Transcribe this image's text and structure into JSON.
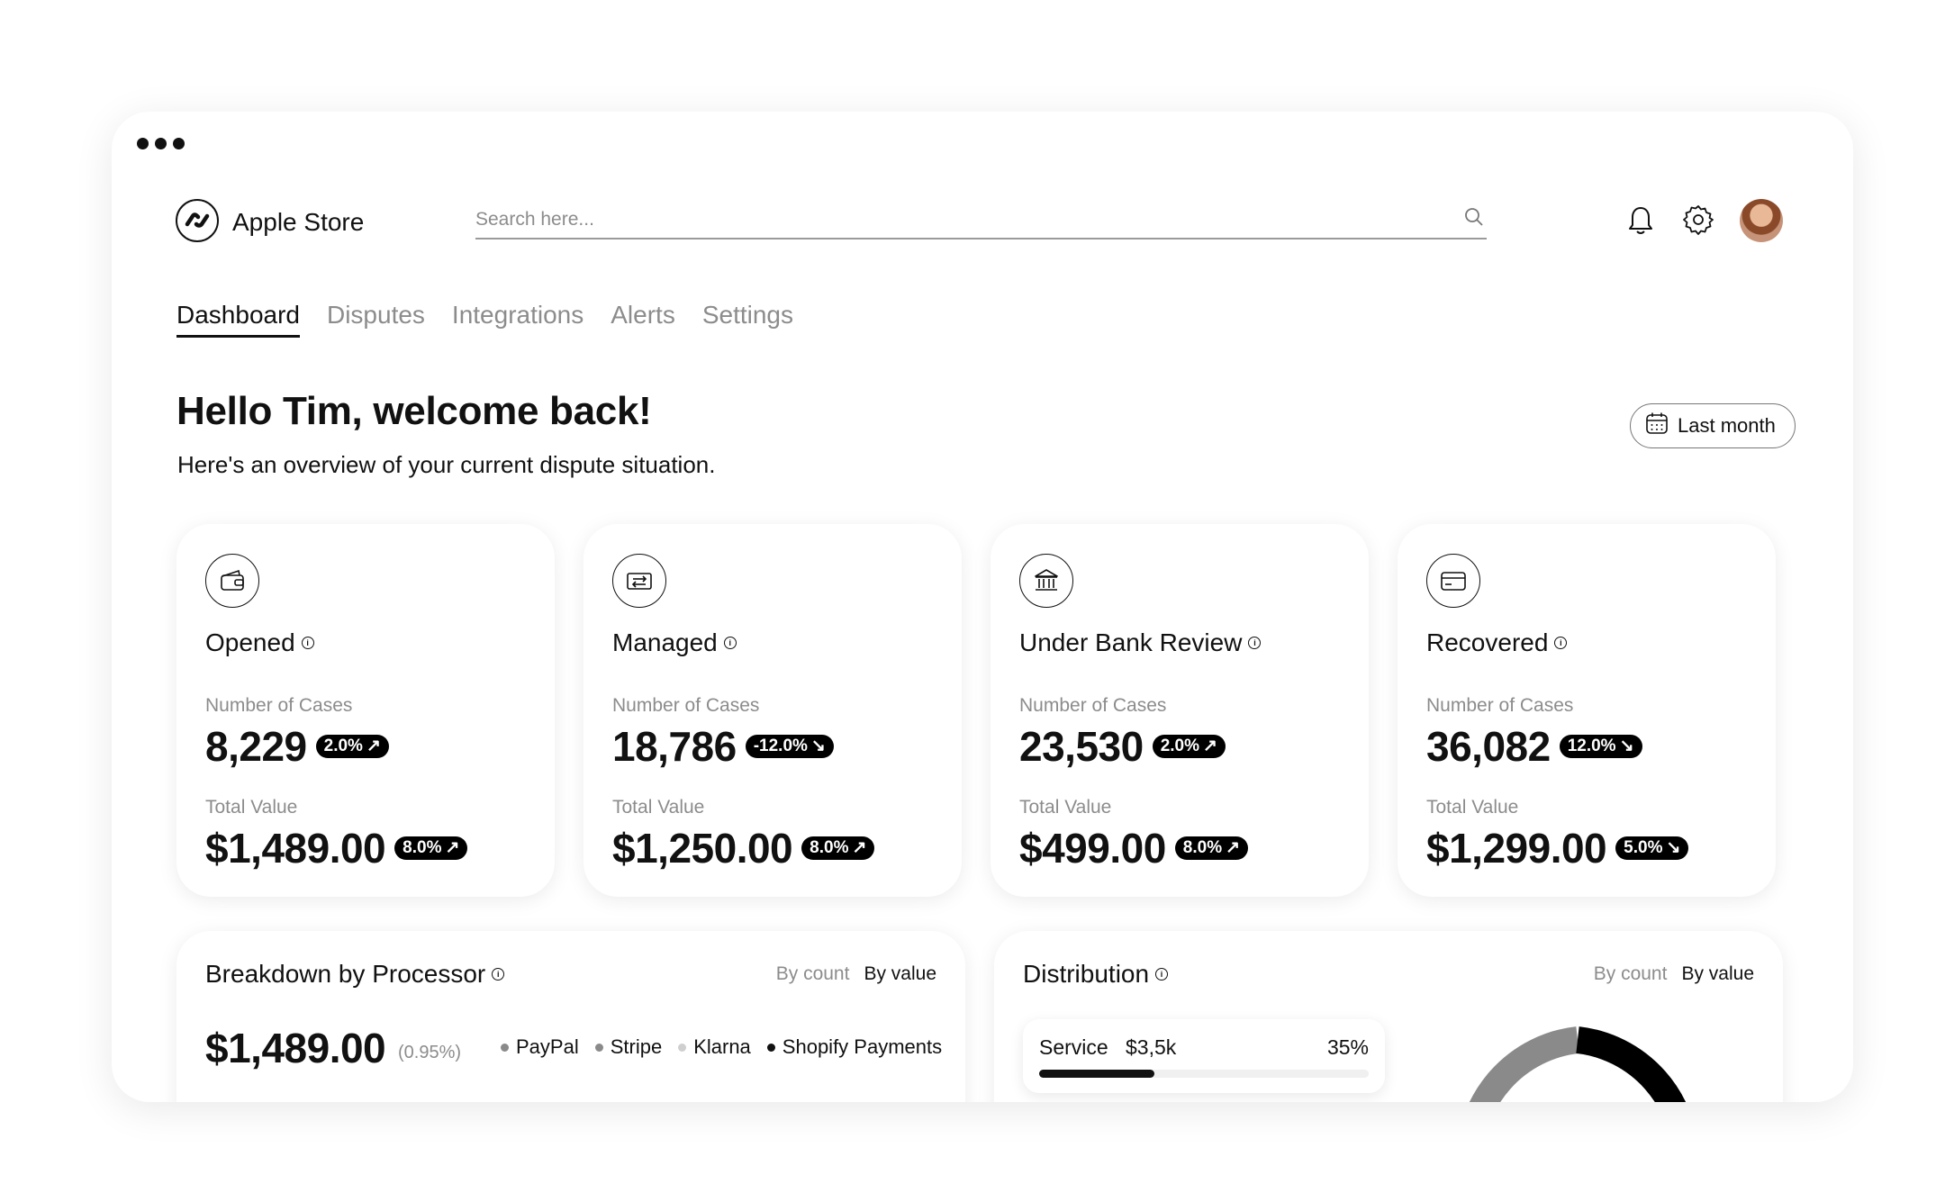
{
  "app": {
    "store_name": "Apple Store"
  },
  "search": {
    "placeholder": "Search here..."
  },
  "tabs": [
    {
      "label": "Dashboard",
      "active": true
    },
    {
      "label": "Disputes"
    },
    {
      "label": "Integrations"
    },
    {
      "label": "Alerts"
    },
    {
      "label": "Settings"
    }
  ],
  "header": {
    "greeting": "Hello Tim, welcome back!",
    "subtitle": "Here's an overview of your current dispute situation.",
    "period_label": "Last month"
  },
  "cards": [
    {
      "title": "Opened",
      "icon": "wallet-icon",
      "cases_label": "Number of Cases",
      "cases_value": "8,229",
      "cases_change": "2.0%",
      "cases_trend": "up",
      "value_label": "Total Value",
      "total_value": "$1,489.00",
      "value_change": "8.0%",
      "value_trend": "up"
    },
    {
      "title": "Managed",
      "icon": "transfer-icon",
      "cases_label": "Number of Cases",
      "cases_value": "18,786",
      "cases_change": "-12.0%",
      "cases_trend": "down",
      "value_label": "Total Value",
      "total_value": "$1,250.00",
      "value_change": "8.0%",
      "value_trend": "up"
    },
    {
      "title": "Under Bank Review",
      "icon": "bank-icon",
      "cases_label": "Number of Cases",
      "cases_value": "23,530",
      "cases_change": "2.0%",
      "cases_trend": "up",
      "value_label": "Total Value",
      "total_value": "$499.00",
      "value_change": "8.0%",
      "value_trend": "up"
    },
    {
      "title": "Recovered",
      "icon": "credit-card-icon",
      "cases_label": "Number of Cases",
      "cases_value": "36,082",
      "cases_change": "12.0%",
      "cases_trend": "down",
      "value_label": "Total Value",
      "total_value": "$1,299.00",
      "value_change": "5.0%",
      "value_trend": "down"
    }
  ],
  "breakdown": {
    "title": "Breakdown by Processor",
    "toggle_count": "By count",
    "toggle_value": "By value",
    "total": "$1,489.00",
    "percent": "(0.95%)",
    "legend": [
      {
        "label": "PayPal",
        "color": "#8a8a8a"
      },
      {
        "label": "Stripe",
        "color": "#8a8a8a"
      },
      {
        "label": "Klarna",
        "color": "#cfcfcf"
      },
      {
        "label": "Shopify Payments",
        "color": "#111111"
      }
    ]
  },
  "distribution": {
    "title": "Distribution",
    "toggle_count": "By count",
    "toggle_value": "By value",
    "service_label": "Service",
    "service_amount": "$3,5k",
    "service_percent": "35%",
    "service_fraction": 0.35
  }
}
